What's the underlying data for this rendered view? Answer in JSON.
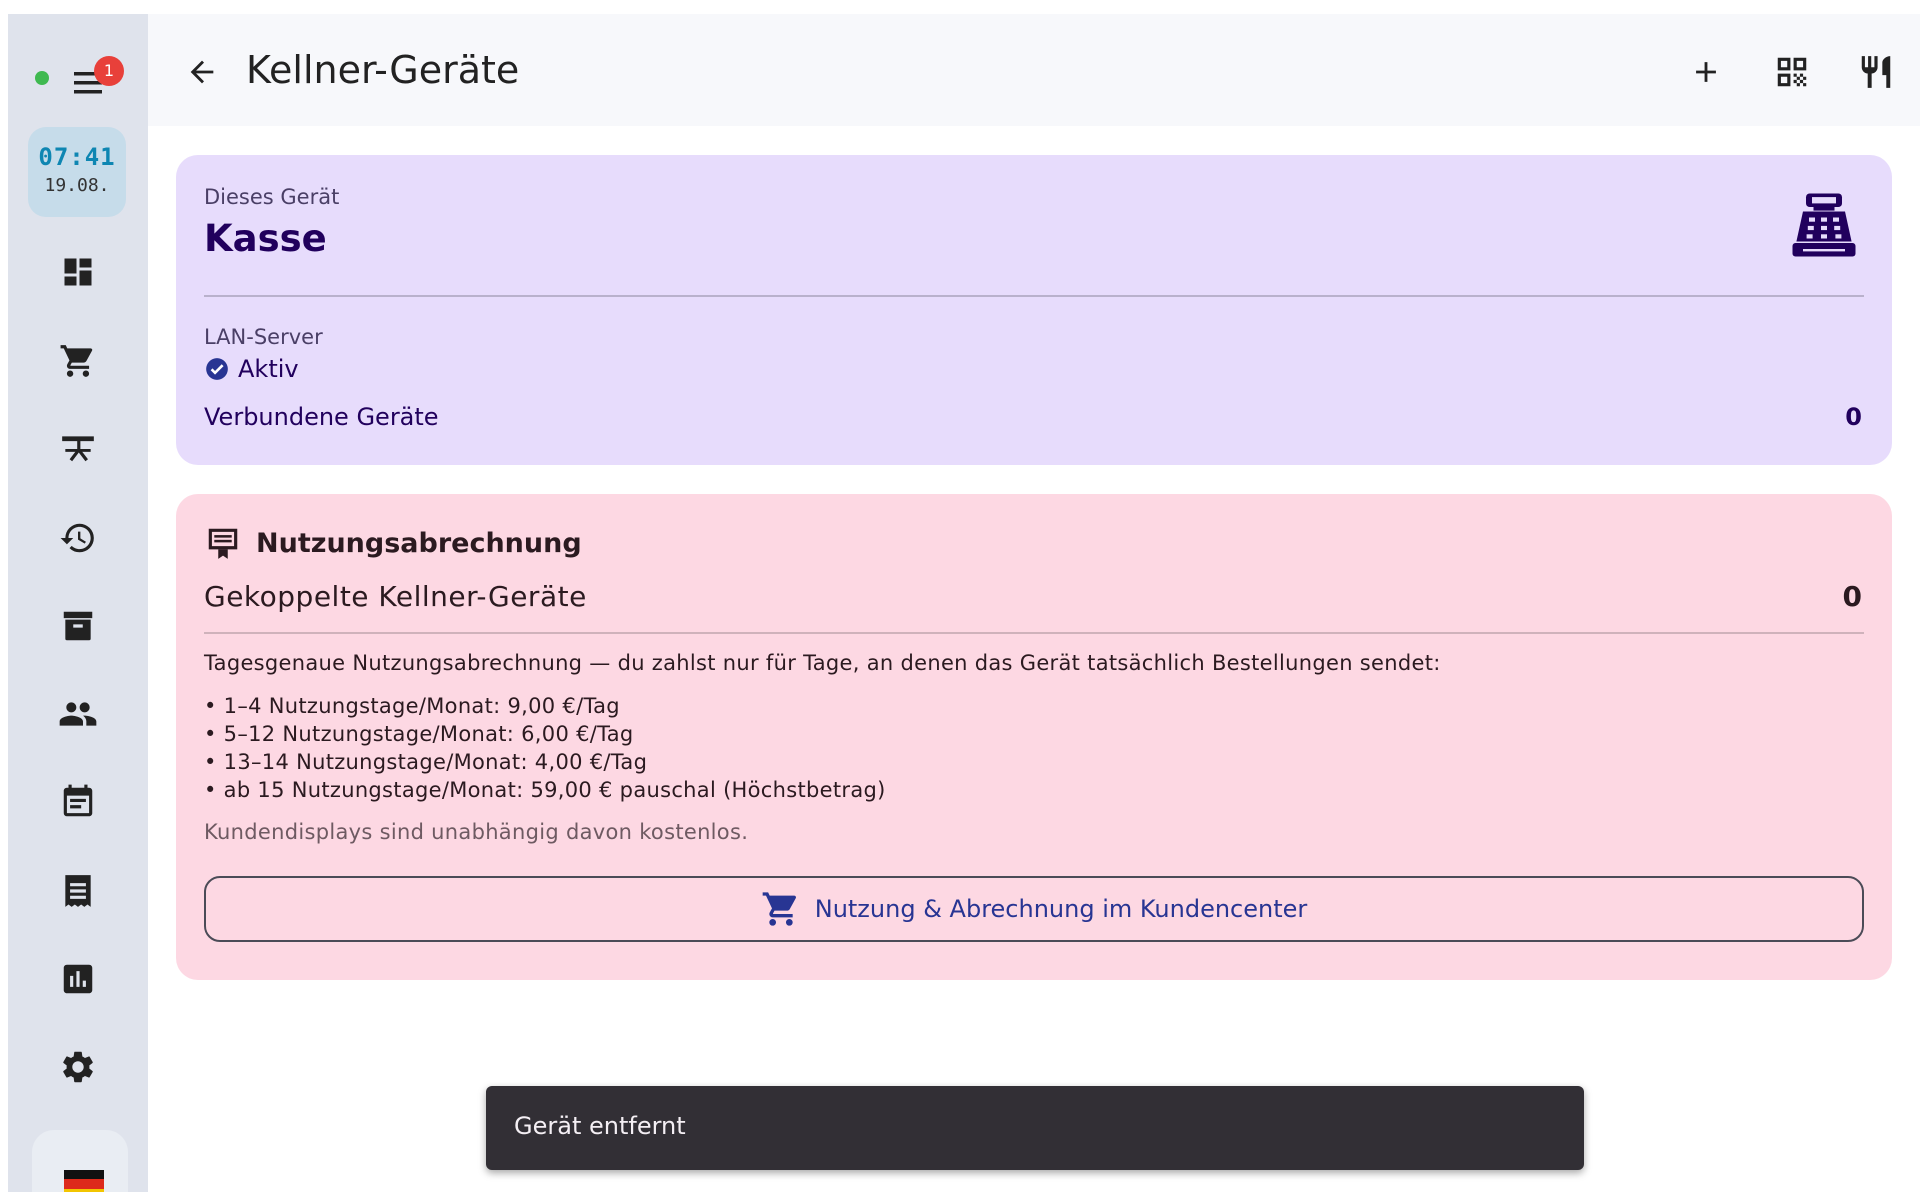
{
  "rail": {
    "notification_count": "1",
    "clock": {
      "time": "07:41",
      "date": "19.08."
    },
    "items": [
      {
        "icon": "dashboard-icon"
      },
      {
        "icon": "cart-icon"
      },
      {
        "icon": "table-icon"
      },
      {
        "icon": "history-icon"
      },
      {
        "icon": "archive-icon"
      },
      {
        "icon": "people-icon"
      },
      {
        "icon": "calendar-icon"
      },
      {
        "icon": "receipt-icon"
      },
      {
        "icon": "statistics-icon"
      },
      {
        "icon": "settings-icon"
      }
    ],
    "language_flag": "german-flag-icon"
  },
  "appbar": {
    "title": "Kellner-Geräte",
    "actions": [
      "add-icon",
      "qr-code-icon",
      "restaurant-icon"
    ]
  },
  "device_card": {
    "label": "Dieses Gerät",
    "name": "Kasse",
    "icon": "cash-register-icon",
    "lan_label": "LAN-Server",
    "lan_status": "Aktiv",
    "connected_label": "Verbundene Geräte",
    "connected_count": "0"
  },
  "billing_card": {
    "title": "Nutzungsabrechnung",
    "paired_label": "Gekoppelte Kellner-Geräte",
    "paired_count": "0",
    "intro": "Tagesgenaue Nutzungsabrechnung — du zahlst nur für Tage, an denen das Gerät tatsächlich Bestellungen sendet:",
    "tiers": [
      "• 1–4 Nutzungstage/Monat: 9,00 €/Tag",
      "• 5–12 Nutzungstage/Monat: 6,00 €/Tag",
      "• 13–14 Nutzungstage/Monat: 4,00 €/Tag",
      "• ab 15 Nutzungstage/Monat: 59,00 € pauschal (Höchstbetrag)"
    ],
    "note": "Kundendisplays sind unabhängig davon kostenlos.",
    "button_label": "Nutzung & Abrechnung im Kundencenter"
  },
  "snackbar": {
    "message": "Gerät entfernt"
  },
  "colors": {
    "rail_bg": "#dfe3ec",
    "device_card_bg": "#e7dcfc",
    "billing_card_bg": "#fdd8e3",
    "accent_dark_purple": "#21005d",
    "button_text": "#283593",
    "status_dot": "#3fb950",
    "badge": "#e8403a",
    "clock_text": "#0e86b2"
  }
}
